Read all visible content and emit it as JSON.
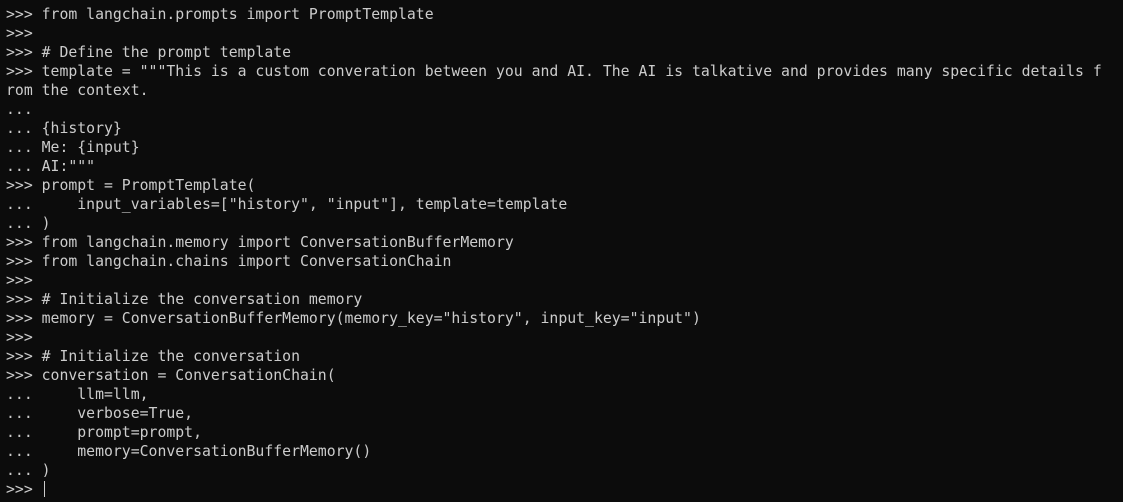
{
  "terminal": {
    "lines": [
      ">>> from langchain.prompts import PromptTemplate",
      ">>>",
      ">>> # Define the prompt template",
      ">>> template = \"\"\"This is a custom converation between you and AI. The AI is talkative and provides many specific details f",
      "rom the context.",
      "...",
      "... {history}",
      "... Me: {input}",
      "... AI:\"\"\"",
      ">>> prompt = PromptTemplate(",
      "...     input_variables=[\"history\", \"input\"], template=template",
      "... )",
      ">>> from langchain.memory import ConversationBufferMemory",
      ">>> from langchain.chains import ConversationChain",
      ">>>",
      ">>> # Initialize the conversation memory",
      ">>> memory = ConversationBufferMemory(memory_key=\"history\", input_key=\"input\")",
      ">>>",
      ">>> # Initialize the conversation",
      ">>> conversation = ConversationChain(",
      "...     llm=llm,",
      "...     verbose=True,",
      "...     prompt=prompt,",
      "...     memory=ConversationBufferMemory()",
      "... )"
    ],
    "prompt": ">>> "
  }
}
